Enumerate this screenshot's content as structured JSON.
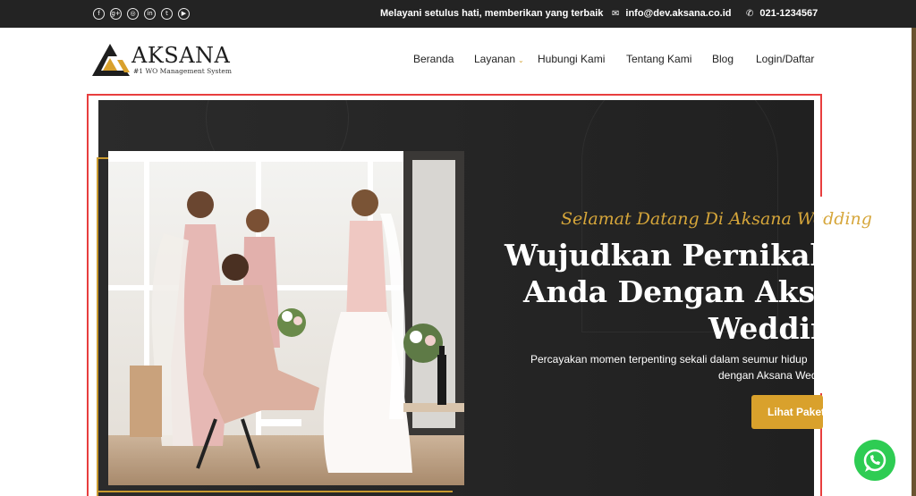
{
  "topbar": {
    "social_icons": [
      "facebook-icon",
      "google-plus-icon",
      "instagram-icon",
      "linkedin-icon",
      "twitter-icon",
      "youtube-icon"
    ],
    "social_glyphs": [
      "f",
      "g+",
      "◎",
      "in",
      "t",
      "▶"
    ],
    "tagline": "Melayani setulus hati, memberikan yang terbaik",
    "email_icon": "✉",
    "email": "info@dev.aksana.co.id",
    "phone_icon": "✆",
    "phone": "021-1234567"
  },
  "header": {
    "logo_name": "AKSANA",
    "logo_tagline": "#1 WO Management System",
    "nav": {
      "beranda": "Beranda",
      "layanan": "Layanan",
      "layanan_chevron": "⌄",
      "hubungi": "Hubungi Kami",
      "tentang": "Tentang Kami",
      "blog": "Blog",
      "login": "Login/Daftar"
    }
  },
  "hero": {
    "welcome": "Selamat Datang Di Aksana Wedding",
    "headline_1": "Wujudkan Pernikahan",
    "headline_2": "Anda Dengan Aksana",
    "headline_3": "Wedding",
    "desc_1": "Percayakan momen terpenting sekali dalam seumur hidup",
    "desc_2": "dengan Aksana Wedding",
    "cta": "Lihat Paket"
  },
  "colors": {
    "accent_gold": "#d9a12c",
    "topbar": "#232323",
    "whatsapp": "#2ecc53"
  }
}
